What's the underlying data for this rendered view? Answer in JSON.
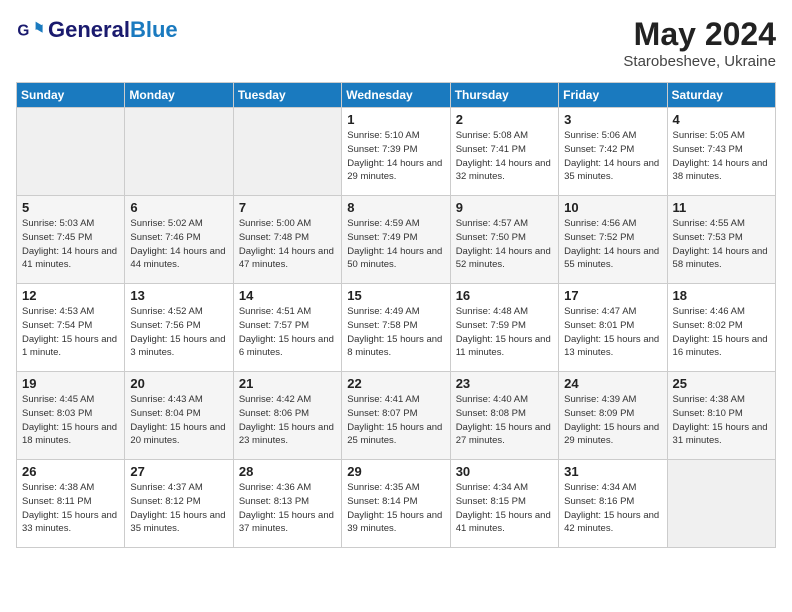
{
  "header": {
    "logo_line1": "General",
    "logo_line2": "Blue",
    "month_title": "May 2024",
    "subtitle": "Starobesheve, Ukraine"
  },
  "weekdays": [
    "Sunday",
    "Monday",
    "Tuesday",
    "Wednesday",
    "Thursday",
    "Friday",
    "Saturday"
  ],
  "weeks": [
    [
      {
        "day": "",
        "empty": true
      },
      {
        "day": "",
        "empty": true
      },
      {
        "day": "",
        "empty": true
      },
      {
        "day": "1",
        "sunrise": "5:10 AM",
        "sunset": "7:39 PM",
        "daylight": "14 hours and 29 minutes."
      },
      {
        "day": "2",
        "sunrise": "5:08 AM",
        "sunset": "7:41 PM",
        "daylight": "14 hours and 32 minutes."
      },
      {
        "day": "3",
        "sunrise": "5:06 AM",
        "sunset": "7:42 PM",
        "daylight": "14 hours and 35 minutes."
      },
      {
        "day": "4",
        "sunrise": "5:05 AM",
        "sunset": "7:43 PM",
        "daylight": "14 hours and 38 minutes."
      }
    ],
    [
      {
        "day": "5",
        "sunrise": "5:03 AM",
        "sunset": "7:45 PM",
        "daylight": "14 hours and 41 minutes."
      },
      {
        "day": "6",
        "sunrise": "5:02 AM",
        "sunset": "7:46 PM",
        "daylight": "14 hours and 44 minutes."
      },
      {
        "day": "7",
        "sunrise": "5:00 AM",
        "sunset": "7:48 PM",
        "daylight": "14 hours and 47 minutes."
      },
      {
        "day": "8",
        "sunrise": "4:59 AM",
        "sunset": "7:49 PM",
        "daylight": "14 hours and 50 minutes."
      },
      {
        "day": "9",
        "sunrise": "4:57 AM",
        "sunset": "7:50 PM",
        "daylight": "14 hours and 52 minutes."
      },
      {
        "day": "10",
        "sunrise": "4:56 AM",
        "sunset": "7:52 PM",
        "daylight": "14 hours and 55 minutes."
      },
      {
        "day": "11",
        "sunrise": "4:55 AM",
        "sunset": "7:53 PM",
        "daylight": "14 hours and 58 minutes."
      }
    ],
    [
      {
        "day": "12",
        "sunrise": "4:53 AM",
        "sunset": "7:54 PM",
        "daylight": "15 hours and 1 minute."
      },
      {
        "day": "13",
        "sunrise": "4:52 AM",
        "sunset": "7:56 PM",
        "daylight": "15 hours and 3 minutes."
      },
      {
        "day": "14",
        "sunrise": "4:51 AM",
        "sunset": "7:57 PM",
        "daylight": "15 hours and 6 minutes."
      },
      {
        "day": "15",
        "sunrise": "4:49 AM",
        "sunset": "7:58 PM",
        "daylight": "15 hours and 8 minutes."
      },
      {
        "day": "16",
        "sunrise": "4:48 AM",
        "sunset": "7:59 PM",
        "daylight": "15 hours and 11 minutes."
      },
      {
        "day": "17",
        "sunrise": "4:47 AM",
        "sunset": "8:01 PM",
        "daylight": "15 hours and 13 minutes."
      },
      {
        "day": "18",
        "sunrise": "4:46 AM",
        "sunset": "8:02 PM",
        "daylight": "15 hours and 16 minutes."
      }
    ],
    [
      {
        "day": "19",
        "sunrise": "4:45 AM",
        "sunset": "8:03 PM",
        "daylight": "15 hours and 18 minutes."
      },
      {
        "day": "20",
        "sunrise": "4:43 AM",
        "sunset": "8:04 PM",
        "daylight": "15 hours and 20 minutes."
      },
      {
        "day": "21",
        "sunrise": "4:42 AM",
        "sunset": "8:06 PM",
        "daylight": "15 hours and 23 minutes."
      },
      {
        "day": "22",
        "sunrise": "4:41 AM",
        "sunset": "8:07 PM",
        "daylight": "15 hours and 25 minutes."
      },
      {
        "day": "23",
        "sunrise": "4:40 AM",
        "sunset": "8:08 PM",
        "daylight": "15 hours and 27 minutes."
      },
      {
        "day": "24",
        "sunrise": "4:39 AM",
        "sunset": "8:09 PM",
        "daylight": "15 hours and 29 minutes."
      },
      {
        "day": "25",
        "sunrise": "4:38 AM",
        "sunset": "8:10 PM",
        "daylight": "15 hours and 31 minutes."
      }
    ],
    [
      {
        "day": "26",
        "sunrise": "4:38 AM",
        "sunset": "8:11 PM",
        "daylight": "15 hours and 33 minutes."
      },
      {
        "day": "27",
        "sunrise": "4:37 AM",
        "sunset": "8:12 PM",
        "daylight": "15 hours and 35 minutes."
      },
      {
        "day": "28",
        "sunrise": "4:36 AM",
        "sunset": "8:13 PM",
        "daylight": "15 hours and 37 minutes."
      },
      {
        "day": "29",
        "sunrise": "4:35 AM",
        "sunset": "8:14 PM",
        "daylight": "15 hours and 39 minutes."
      },
      {
        "day": "30",
        "sunrise": "4:34 AM",
        "sunset": "8:15 PM",
        "daylight": "15 hours and 41 minutes."
      },
      {
        "day": "31",
        "sunrise": "4:34 AM",
        "sunset": "8:16 PM",
        "daylight": "15 hours and 42 minutes."
      },
      {
        "day": "",
        "empty": true
      }
    ]
  ]
}
